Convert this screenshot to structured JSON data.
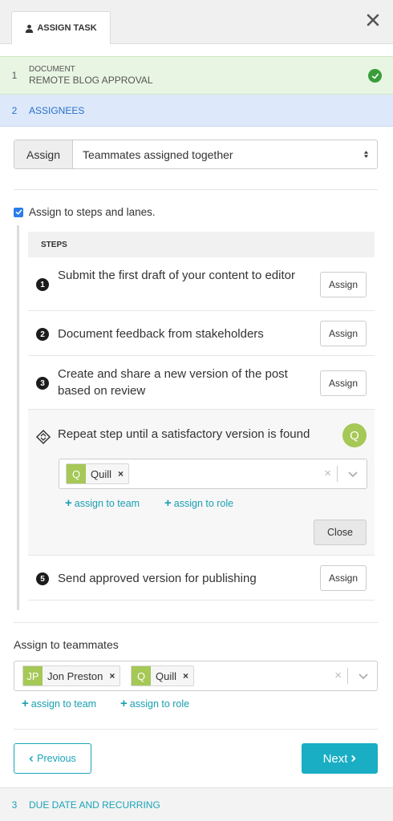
{
  "header": {
    "tab_label": "ASSIGN TASK",
    "tab_icon": "user-icon",
    "close_icon": "close-icon"
  },
  "wizard": {
    "step1": {
      "number": "1",
      "label": "DOCUMENT",
      "value": "REMOTE BLOG APPROVAL",
      "status_icon": "check-circle-icon"
    },
    "step2": {
      "number": "2",
      "label": "ASSIGNEES"
    },
    "step3": {
      "number": "3",
      "label": "DUE DATE AND RECURRING"
    }
  },
  "assign_mode": {
    "addon_label": "Assign",
    "selected": "Teammates assigned together"
  },
  "assign_to_steps": {
    "checked": true,
    "label": "Assign to steps and lanes."
  },
  "steps": {
    "header": "STEPS",
    "items": [
      {
        "number": "1",
        "text": "Submit the first draft of your content to editor",
        "button": "Assign"
      },
      {
        "number": "2",
        "text": "Document feedback from stakeholders",
        "button": "Assign"
      },
      {
        "number": "3",
        "text": "Create and share a new version of the post based on review",
        "button": "Assign"
      },
      {
        "icon": "repeat-diamond-icon",
        "text": "Repeat step until a satisfactory version is found",
        "avatar": "Q",
        "assignees": [
          {
            "initials": "Q",
            "name": "Quill"
          }
        ],
        "clear": "×",
        "assign_to_team": "assign to team",
        "assign_to_role": "assign to role",
        "close_button": "Close"
      },
      {
        "number": "5",
        "text": "Send approved version for publishing",
        "button": "Assign"
      }
    ]
  },
  "teammates": {
    "label": "Assign to teammates",
    "assignees": [
      {
        "initials": "JP",
        "name": "Jon Preston"
      },
      {
        "initials": "Q",
        "name": "Quill"
      }
    ],
    "clear": "×",
    "assign_to_team": "assign to team",
    "assign_to_role": "assign to role"
  },
  "footer": {
    "previous": "Previous",
    "next": "Next"
  },
  "colors": {
    "accent": "#19aec4",
    "avatar_green": "#a5c857",
    "active_step_bg": "#dde9fb",
    "done_step_bg": "#e8f5e3"
  }
}
